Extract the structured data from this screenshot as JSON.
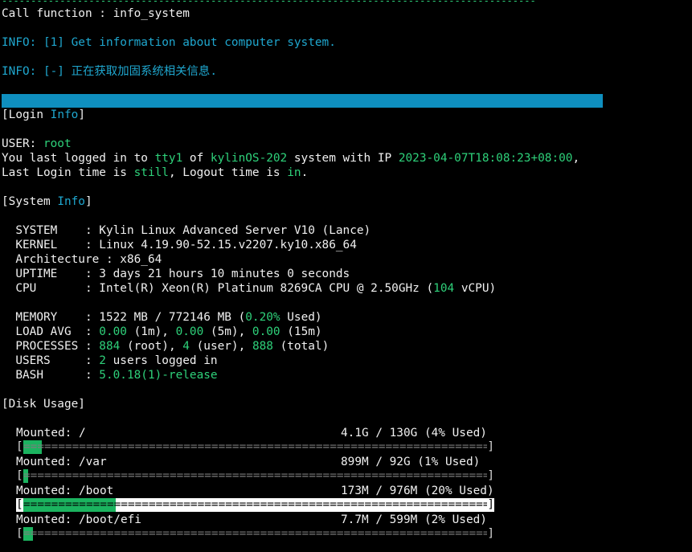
{
  "header": {
    "call": "Call function : info_system",
    "info1": "INFO: [1] Get information about computer system.",
    "info2": "INFO: [-] 正在获取加固系统相关信息.",
    "progress": 1.0
  },
  "login": {
    "section_open": "[Login ",
    "section_key": "Info",
    "section_close": "]",
    "user_label": "USER: ",
    "user": "root",
    "line2_a": "You last logged in to ",
    "tty": "tty1",
    "line2_b": " of ",
    "host": "kylinOS-202",
    "line2_c": " system with IP ",
    "ip": "2023-04-07T18:08:23+08:00",
    "line2_d": ",",
    "line3_a": "Last Login time is ",
    "last": "still",
    "line3_b": ", Logout time is ",
    "logout": "in",
    "line3_c": "."
  },
  "system": {
    "section_open": "[System ",
    "section_key": "Info",
    "section_close": "]",
    "system": "  SYSTEM    : Kylin Linux Advanced Server V10 (Lance)",
    "kernel": "  KERNEL    : Linux 4.19.90-52.15.v2207.ky10.x86_64",
    "arch": "  Architecture : x86_64",
    "uptime": "  UPTIME    : 3 days 21 hours 10 minutes 0 seconds",
    "cpu_a": "  CPU       : Intel(R) Xeon(R) Platinum 8269CA CPU @ 2.50GHz (",
    "cpu_n": "104",
    "cpu_b": " vCPU)",
    "mem_a": "  MEMORY    : 1522 MB / 772146 MB (",
    "mem_p": "0.20%",
    "mem_b": " Used)",
    "load_a": "  LOAD AVG  : ",
    "load_1": "0.00",
    "load_1s": " (1m), ",
    "load_5": "0.00",
    "load_5s": " (5m), ",
    "load_15": "0.00",
    "load_15s": " (15m)",
    "proc_a": "  PROCESSES : ",
    "proc_root": "884",
    "proc_rs": " (root), ",
    "proc_user": "4",
    "proc_us": " (user), ",
    "proc_total": "888",
    "proc_ts": " (total)",
    "users_a": "  USERS     : ",
    "users_n": "2",
    "users_b": " users logged in",
    "bash_a": "  BASH      : ",
    "bash_v": "5.0.18(1)-release"
  },
  "disk": {
    "section": "[Disk Usage]",
    "items": [
      {
        "mount": "Mounted: /",
        "usage": "4.1G / 130G (4% Used)",
        "pct": 0.04,
        "highlight": false
      },
      {
        "mount": "Mounted: /var",
        "usage": "899M / 92G (1% Used)",
        "pct": 0.01,
        "highlight": false
      },
      {
        "mount": "Mounted: /boot",
        "usage": "173M / 976M (20% Used)",
        "pct": 0.2,
        "highlight": true
      },
      {
        "mount": "Mounted: /boot/efi",
        "usage": "7.7M / 599M (2% Used)",
        "pct": 0.02,
        "highlight": false
      }
    ],
    "bracket_open": "[",
    "bracket_close": "]"
  },
  "colors": {
    "info": "#1fa7cf",
    "green": "#2ed17a",
    "bar": "#0f8fbf",
    "fill": "#1bb35f"
  }
}
